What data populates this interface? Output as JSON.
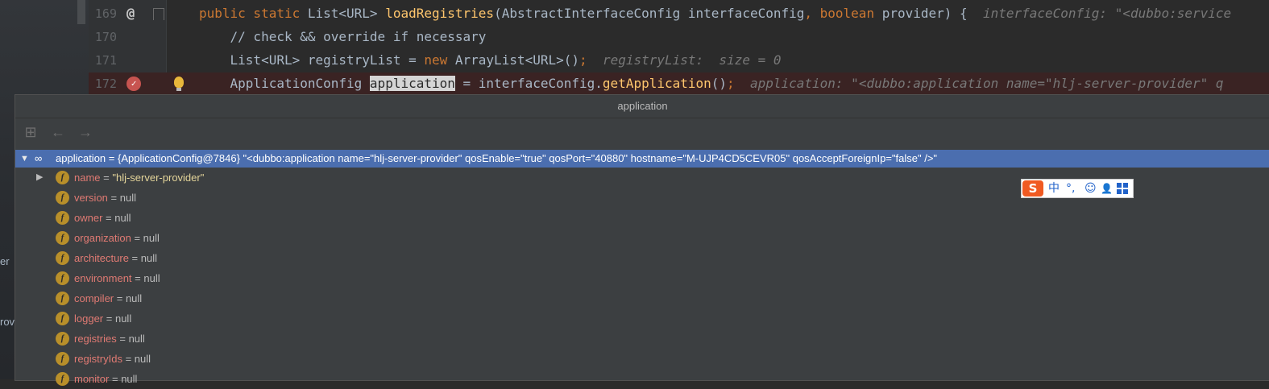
{
  "outer": {
    "side_text_1": "er",
    "side_text_2": "rov"
  },
  "editor": {
    "lines": [
      {
        "number": "169",
        "code_parts": {
          "p1": "public static ",
          "p2": "List",
          "p3": "<URL>",
          "p4": " loadRegistries",
          "p5": "(AbstractInterfaceConfig interfaceConfig",
          "p6": ", ",
          "p7": "boolean",
          "p8": " provider) {",
          "hint": "  interfaceConfig: \"<dubbo:service"
        }
      },
      {
        "number": "170",
        "code": "    // check && override if necessary"
      },
      {
        "number": "171",
        "code_parts": {
          "p1": "    List",
          "p2": "<URL>",
          "p3": " registryList = ",
          "p4": "new ",
          "p5": "ArrayList",
          "p6": "<URL>",
          "p7": "()",
          "p8": ";",
          "hint": "  registryList:  size = 0"
        }
      },
      {
        "number": "172",
        "code_parts": {
          "p1": "    ApplicationConfig ",
          "p2": "application",
          "p3": " = interfaceConfig.",
          "p4": "getApplication",
          "p5": "()",
          "p6": ";",
          "hint": "  application: \"<dubbo:application name=\"hlj-server-provider\" q"
        }
      }
    ]
  },
  "popup": {
    "title": "application",
    "toolbar": {
      "add_icon": "watch-icon",
      "back_icon": "arrow-left-icon",
      "forward_icon": "arrow-right-icon"
    },
    "root": {
      "text": "application = {ApplicationConfig@7846} \"<dubbo:application name=\"hlj-server-provider\" qosEnable=\"true\" qosPort=\"40880\" hostname=\"M-UJP4CD5CEVR05\" qosAcceptForeignIp=\"false\" />\""
    },
    "fields": [
      {
        "name": "name",
        "value": "\"hlj-server-provider\"",
        "expandable": true
      },
      {
        "name": "version",
        "value": "null"
      },
      {
        "name": "owner",
        "value": "null"
      },
      {
        "name": "organization",
        "value": "null"
      },
      {
        "name": "architecture",
        "value": "null"
      },
      {
        "name": "environment",
        "value": "null"
      },
      {
        "name": "compiler",
        "value": "null"
      },
      {
        "name": "logger",
        "value": "null"
      },
      {
        "name": "registries",
        "value": "null"
      },
      {
        "name": "registryIds",
        "value": "null"
      },
      {
        "name": "monitor",
        "value": "null"
      }
    ],
    "field_badge": "f",
    "equals": " = "
  },
  "ime": {
    "logo": "S",
    "lang": "中",
    "punct": "°,",
    "emoji": "☺",
    "user": "👤"
  },
  "colors": {
    "selection": "#4b6eaf",
    "breakpoint_line": "#3a2323",
    "field_name": "#e07a73",
    "string_value": "#e4d59a"
  }
}
